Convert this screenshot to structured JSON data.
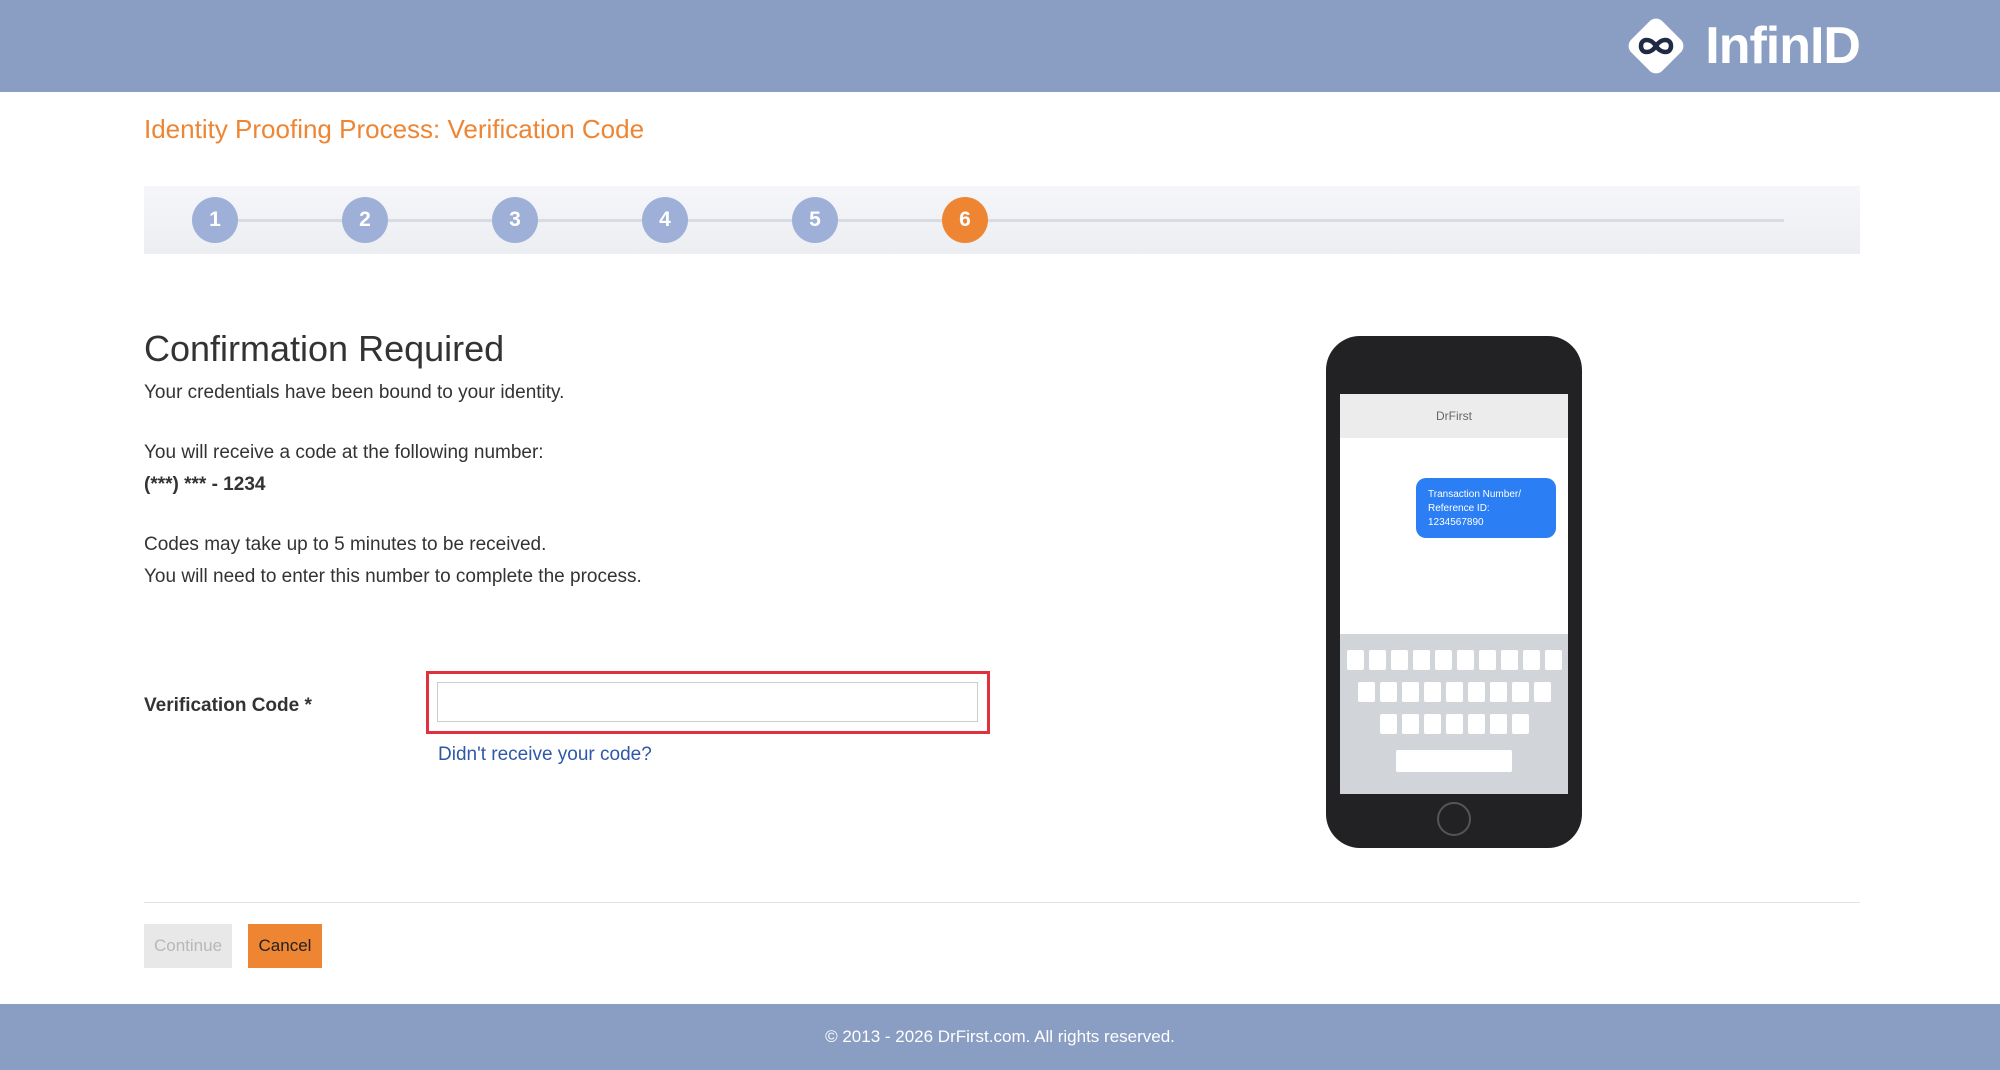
{
  "header": {
    "logo_text": "InfinID",
    "logo_icon": "infinity-icon"
  },
  "page": {
    "title": "Identity Proofing Process: Verification Code"
  },
  "stepper": {
    "steps": [
      "1",
      "2",
      "3",
      "4",
      "5",
      "6"
    ],
    "active_step": 6
  },
  "content": {
    "heading": "Confirmation Required",
    "line1": "Your credentials have been bound to your identity.",
    "line2": "You will receive a code at the following number:",
    "phone_number": "(***) *** - 1234",
    "line3": "Codes may take up to 5 minutes to be received.",
    "line4": "You will need to enter this number to complete the process."
  },
  "form": {
    "label": "Verification Code *",
    "value": "",
    "placeholder": "",
    "resend_link": "Didn't receive your code?"
  },
  "phone_illustration": {
    "sender": "DrFirst",
    "message_line1": "Transaction Number/",
    "message_line2": "Reference ID:",
    "message_line3": "1234567890"
  },
  "actions": {
    "continue_label": "Continue",
    "cancel_label": "Cancel"
  },
  "footer": {
    "copyright": "© 2013 - 2026 DrFirst.com. All rights reserved."
  },
  "colors": {
    "brand_bar": "#8a9ec3",
    "accent_orange": "#ee8533",
    "step_inactive": "#9eb0d8",
    "error_border": "#e0313d",
    "link_blue": "#2f58a9"
  }
}
